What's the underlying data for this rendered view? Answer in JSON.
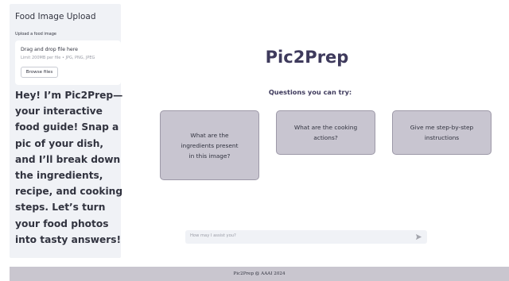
{
  "sidebar": {
    "title": "Food Image Upload",
    "upload_label": "Upload a food image",
    "dropzone": {
      "main_text": "Drag and drop file here",
      "sub_text": "Limit 200MB per file • JPG, PNG, JPEG",
      "browse_button": "Browse files"
    },
    "intro_text": "Hey! I’m Pic2Prep—your interactive food guide! Snap a pic of your dish, and I’ll break down the ingredients, recipe, and cooking steps. Let’s turn your food photos into tasty answers!"
  },
  "main": {
    "app_title": "Pic2Prep",
    "questions_label": "Questions you can try:",
    "questions": [
      "What are the ingredients present in this image?",
      "What are the cooking actions?",
      "Give me step-by-step instructions"
    ]
  },
  "chat": {
    "placeholder": "How may I assist you?",
    "send_icon": "paper-plane-icon"
  },
  "footer": {
    "text": "Pic2Prep @ AAAI 2024"
  },
  "colors": {
    "sidebar_bg": "#f0f2f6",
    "title_color": "#3e3a5c",
    "card_bg": "#c8c5d0",
    "footer_bg": "#c9c6cf"
  }
}
